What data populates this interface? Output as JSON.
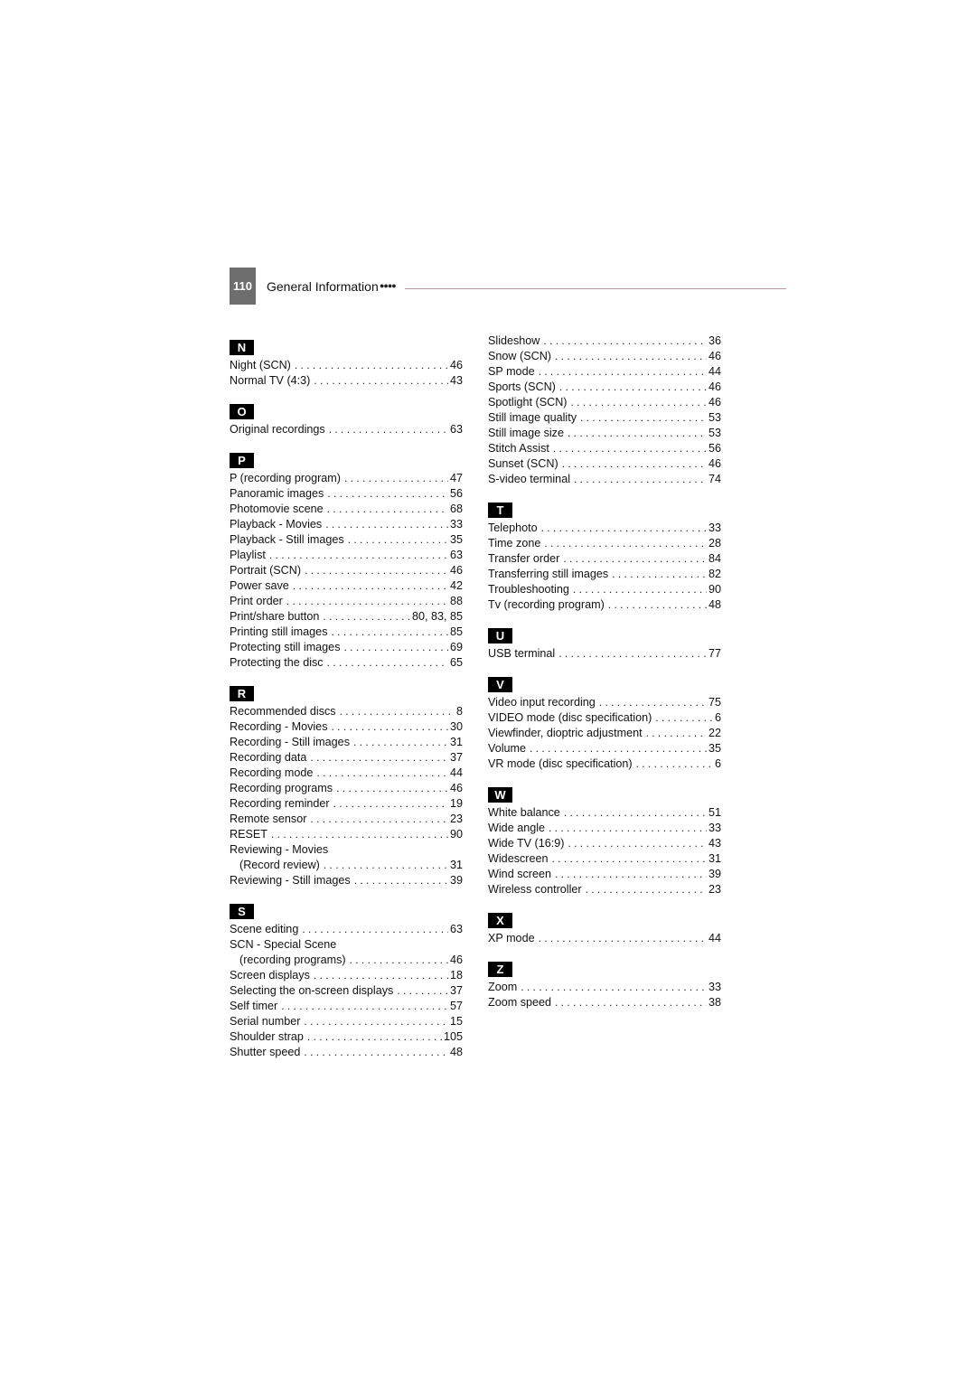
{
  "header": {
    "page_number": "110",
    "section_title": "General Information",
    "dots": "●●●●"
  },
  "left_column": [
    {
      "letter": "N",
      "entries": [
        {
          "label": "Night (SCN)",
          "page": "46"
        },
        {
          "label": "Normal TV (4:3)",
          "page": "43"
        }
      ]
    },
    {
      "letter": "O",
      "entries": [
        {
          "label": "Original recordings",
          "page": "63"
        }
      ]
    },
    {
      "letter": "P",
      "entries": [
        {
          "label": "P (recording program)",
          "page": "47"
        },
        {
          "label": "Panoramic images",
          "page": "56"
        },
        {
          "label": "Photomovie scene",
          "page": "68"
        },
        {
          "label": "Playback - Movies",
          "page": "33"
        },
        {
          "label": "Playback - Still images",
          "page": "35"
        },
        {
          "label": "Playlist",
          "page": "63"
        },
        {
          "label": "Portrait (SCN)",
          "page": "46"
        },
        {
          "label": "Power save",
          "page": "42"
        },
        {
          "label": "Print order",
          "page": "88"
        },
        {
          "label": "Print/share button",
          "page": "80, 83, 85"
        },
        {
          "label": "Printing still images",
          "page": "85"
        },
        {
          "label": "Protecting still images",
          "page": "69"
        },
        {
          "label": "Protecting the disc",
          "page": "65"
        }
      ]
    },
    {
      "letter": "R",
      "entries": [
        {
          "label": "Recommended discs",
          "page": "8"
        },
        {
          "label": "Recording - Movies",
          "page": "30"
        },
        {
          "label": "Recording - Still images",
          "page": "31"
        },
        {
          "label": "Recording data",
          "page": "37"
        },
        {
          "label": "Recording mode",
          "page": "44"
        },
        {
          "label": "Recording programs",
          "page": "46"
        },
        {
          "label": "Recording reminder",
          "page": "19"
        },
        {
          "label": "Remote sensor",
          "page": "23"
        },
        {
          "label": "RESET",
          "page": "90"
        },
        {
          "label": "Reviewing - Movies",
          "page": ""
        },
        {
          "label": "(Record review)",
          "page": "31",
          "sub": true
        },
        {
          "label": "Reviewing - Still images",
          "page": "39"
        }
      ]
    },
    {
      "letter": "S",
      "entries": [
        {
          "label": "Scene editing",
          "page": "63"
        },
        {
          "label": "SCN - Special Scene",
          "page": ""
        },
        {
          "label": "(recording programs)",
          "page": "46",
          "sub": true
        },
        {
          "label": "Screen displays",
          "page": "18"
        },
        {
          "label": "Selecting the on-screen displays",
          "page": "37"
        },
        {
          "label": "Self timer",
          "page": "57"
        },
        {
          "label": "Serial number",
          "page": "15"
        },
        {
          "label": "Shoulder strap",
          "page": "105"
        },
        {
          "label": "Shutter speed",
          "page": "48"
        }
      ]
    }
  ],
  "right_column": [
    {
      "letter": "",
      "entries": [
        {
          "label": "Slideshow",
          "page": "36"
        },
        {
          "label": "Snow (SCN)",
          "page": "46"
        },
        {
          "label": "SP mode",
          "page": "44"
        },
        {
          "label": "Sports (SCN)",
          "page": "46"
        },
        {
          "label": "Spotlight (SCN)",
          "page": "46"
        },
        {
          "label": "Still image quality",
          "page": "53"
        },
        {
          "label": "Still image size",
          "page": "53"
        },
        {
          "label": "Stitch Assist",
          "page": "56"
        },
        {
          "label": "Sunset (SCN)",
          "page": "46"
        },
        {
          "label": "S-video terminal",
          "page": "74"
        }
      ]
    },
    {
      "letter": "T",
      "entries": [
        {
          "label": "Telephoto",
          "page": "33"
        },
        {
          "label": "Time zone",
          "page": "28"
        },
        {
          "label": "Transfer order",
          "page": "84"
        },
        {
          "label": "Transferring still images",
          "page": "82"
        },
        {
          "label": "Troubleshooting",
          "page": "90"
        },
        {
          "label": "Tv (recording program)",
          "page": "48"
        }
      ]
    },
    {
      "letter": "U",
      "entries": [
        {
          "label": "USB terminal",
          "page": "77"
        }
      ]
    },
    {
      "letter": "V",
      "entries": [
        {
          "label": "Video input recording",
          "page": "75"
        },
        {
          "label": "VIDEO mode (disc specification)",
          "page": "6"
        },
        {
          "label": "Viewfinder, dioptric adjustment",
          "page": "22"
        },
        {
          "label": "Volume",
          "page": "35"
        },
        {
          "label": "VR mode (disc specification)",
          "page": "6"
        }
      ]
    },
    {
      "letter": "W",
      "entries": [
        {
          "label": "White balance",
          "page": "51"
        },
        {
          "label": "Wide angle",
          "page": "33"
        },
        {
          "label": "Wide TV (16:9)",
          "page": "43"
        },
        {
          "label": "Widescreen",
          "page": "31"
        },
        {
          "label": "Wind screen",
          "page": "39"
        },
        {
          "label": "Wireless controller",
          "page": "23"
        }
      ]
    },
    {
      "letter": "X",
      "entries": [
        {
          "label": "XP mode",
          "page": "44"
        }
      ]
    },
    {
      "letter": "Z",
      "entries": [
        {
          "label": "Zoom",
          "page": "33"
        },
        {
          "label": "Zoom speed",
          "page": "38"
        }
      ]
    }
  ]
}
